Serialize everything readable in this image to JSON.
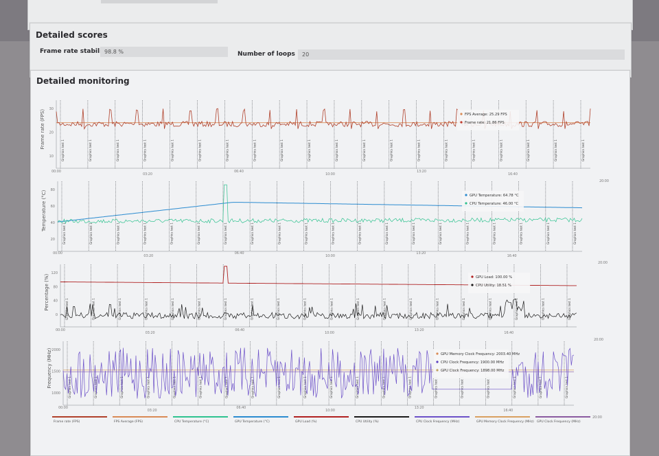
{
  "top_card": {},
  "scores": {
    "title": "Detailed scores",
    "fields": [
      {
        "label": "Frame rate stability",
        "value": "98.8 %"
      },
      {
        "label": "Number of loops",
        "value": "20"
      }
    ]
  },
  "monitoring": {
    "title": "Detailed monitoring",
    "x_ticks": [
      "00:00",
      "03:20",
      "06:40",
      "10:00",
      "13:20",
      "16:40",
      "20:00"
    ],
    "marker_label": "Graphics test 1",
    "charts": [
      {
        "ylabel": "Frame rate (FPS)",
        "yticks": [
          "30",
          "20",
          "10"
        ],
        "tooltip": [
          {
            "text": "FPS Average: 25.29 FPS",
            "color": "#d98a55"
          },
          {
            "text": "Frame rate: 21.86 FPS",
            "color": "#c0392b"
          }
        ]
      },
      {
        "ylabel": "Temperature (°C)",
        "yticks": [
          "80",
          "60",
          "40",
          "20"
        ],
        "tooltip": [
          {
            "text": "GPU Temperature: 64.78 °C",
            "color": "#2a8bd0"
          },
          {
            "text": "CPU Temperature: 46.00 °C",
            "color": "#2ec28f"
          }
        ]
      },
      {
        "ylabel": "Percentage (%)",
        "yticks": [
          "120",
          "80",
          "40",
          "0"
        ],
        "tooltip": [
          {
            "text": "GPU Load: 100.00 %",
            "color": "#b02020"
          },
          {
            "text": "CPU Utility: 18.51 %",
            "color": "#1a1a1a"
          }
        ]
      },
      {
        "ylabel": "Frequency (MHz)",
        "yticks": [
          "2000",
          "1500",
          "1000"
        ],
        "tooltip": [
          {
            "text": "GPU Memory Clock Frequency: 2003.40 MHz",
            "color": "#d98a55"
          },
          {
            "text": "CPU Clock Frequency: 1900.00 MHz",
            "color": "#5b3fc0"
          },
          {
            "text": "GPU Clock Frequency: 1898.00 MHz",
            "color": "#c0a060"
          }
        ]
      }
    ],
    "legend": [
      {
        "label": "Frame rate (FPS)",
        "color": "#b0402a"
      },
      {
        "label": "FPS Average (FPS)",
        "color": "#d98a55"
      },
      {
        "label": "CPU Temperature (°C)",
        "color": "#2ec28f"
      },
      {
        "label": "GPU Temperature (°C)",
        "color": "#2a8bd0"
      },
      {
        "label": "GPU Load (%)",
        "color": "#b02020"
      },
      {
        "label": "CPU Utility (%)",
        "color": "#1a1a1a"
      },
      {
        "label": "CPU Clock Frequency (MHz)",
        "color": "#6b4fc8"
      },
      {
        "label": "GPU Memory Clock Frequency (MHz)",
        "color": "#d9a060"
      },
      {
        "label": "GPU Clock Frequency (MHz)",
        "color": "#8a5aa0"
      }
    ]
  }
}
